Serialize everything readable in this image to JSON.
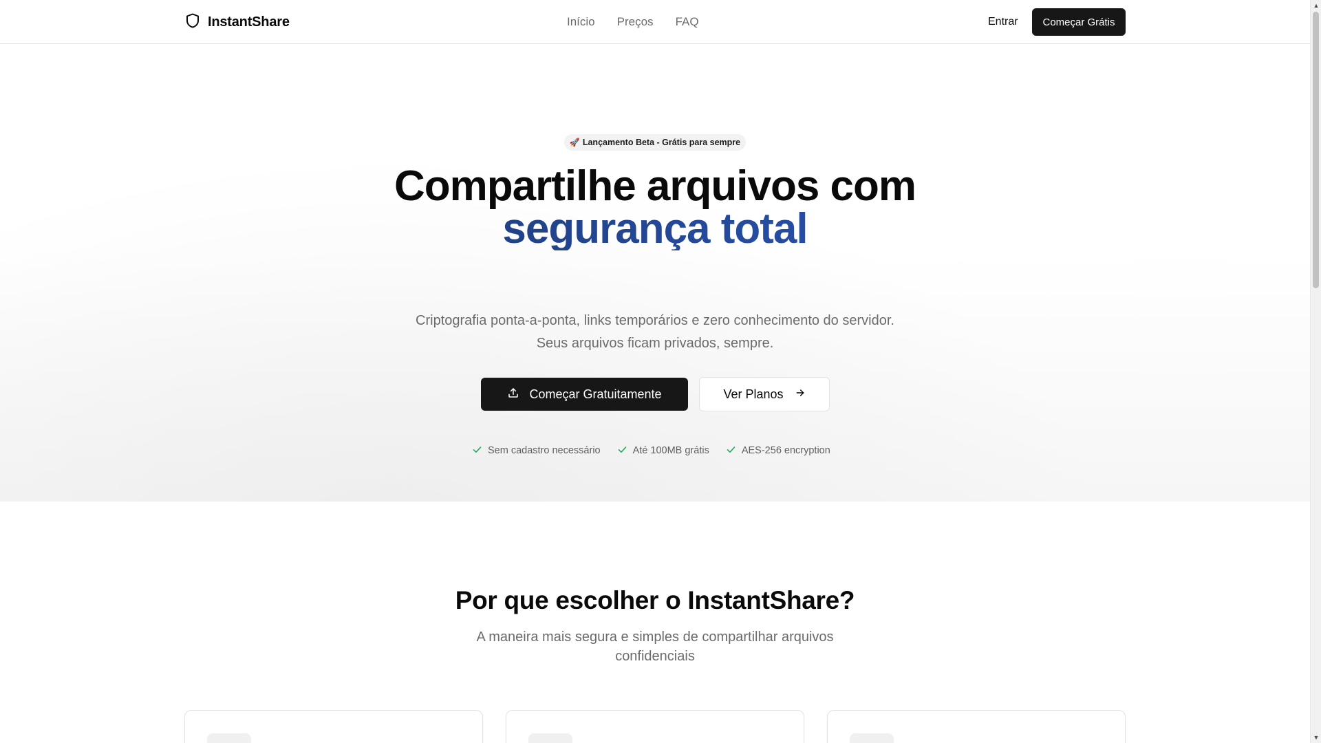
{
  "header": {
    "brand": "InstantShare",
    "nav": [
      {
        "label": "Início"
      },
      {
        "label": "Preços"
      },
      {
        "label": "FAQ"
      }
    ],
    "login_label": "Entrar",
    "cta_label": "Começar Grátis"
  },
  "hero": {
    "badge_emoji": "🚀",
    "badge_text": "Lançamento Beta - Grátis para sempre",
    "title_line1": "Compartilhe arquivos com",
    "title_line2": "segurança total",
    "subtitle": "Criptografia ponta-a-ponta, links temporários e zero conhecimento do servidor. Seus arquivos ficam privados, sempre.",
    "primary_button": "Começar Gratuitamente",
    "secondary_button": "Ver Planos",
    "features": [
      {
        "label": "Sem cadastro necessário"
      },
      {
        "label": "Até 100MB grátis"
      },
      {
        "label": "AES-256 encryption"
      }
    ]
  },
  "why": {
    "title": "Por que escolher o InstantShare?",
    "subtitle": "A maneira mais segura e simples de compartilhar arquivos confidenciais"
  },
  "colors": {
    "primary": "#171717",
    "accent_gradient_start": "#1e3a75",
    "accent_gradient_end": "#2a55b5",
    "check_green": "#22a55b",
    "muted_text": "#6b6b6b"
  },
  "icons": {
    "logo": "shield-icon",
    "primary_button": "upload-icon",
    "secondary_button": "arrow-right-icon",
    "feature": "check-icon"
  }
}
